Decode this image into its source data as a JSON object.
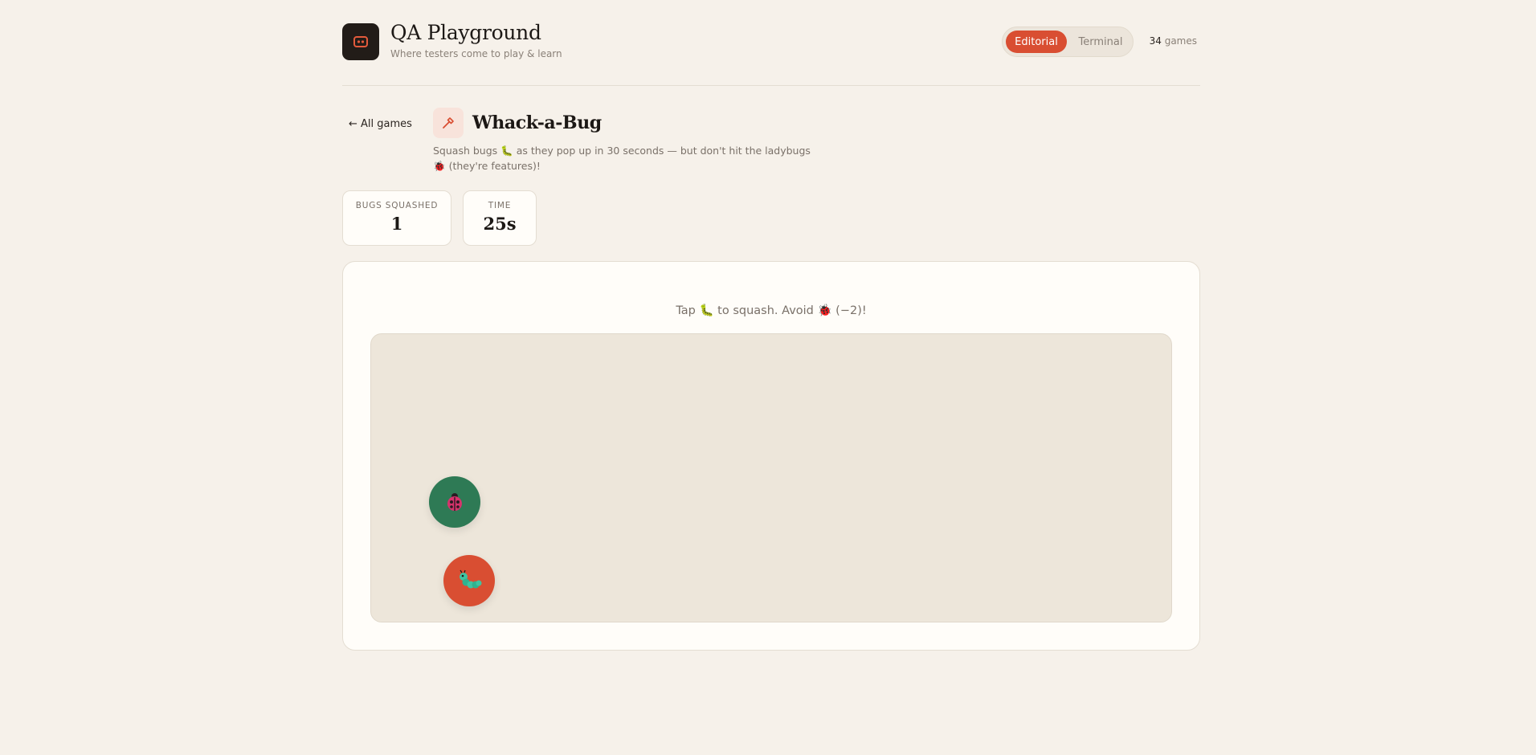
{
  "header": {
    "brand_title": "QA Playground",
    "brand_subtitle": "Where testers come to play & learn",
    "logo_icon": "robot-face-icon",
    "modes": [
      "Editorial",
      "Terminal"
    ],
    "active_mode": "Editorial",
    "games_count": "34",
    "games_suffix": "games"
  },
  "game": {
    "back_label": "← All games",
    "icon": "hammer-icon",
    "title": "Whack-a-Bug",
    "description_part1": "Squash bugs",
    "description_part2": "as they pop up in 30 seconds — but don't hit the ladybugs",
    "description_part3": "(they're features)!"
  },
  "stats": {
    "bugs_label": "BUGS SQUASHED",
    "bugs_value": "1",
    "time_label": "TIME",
    "time_value": "25s"
  },
  "board": {
    "instruction_part1": "Tap",
    "instruction_part2": "to squash. Avoid",
    "instruction_part3": "(−2)!",
    "targets": [
      {
        "kind": "ladybug",
        "icon": "ladybug-icon",
        "color": "#2e7a55"
      },
      {
        "kind": "bug",
        "icon": "caterpillar-icon",
        "color": "#d94e32"
      }
    ]
  },
  "colors": {
    "accent": "#d94e32",
    "background": "#f6f1ea",
    "logo_bg": "#221c18",
    "arena_bg": "#ede6da"
  }
}
